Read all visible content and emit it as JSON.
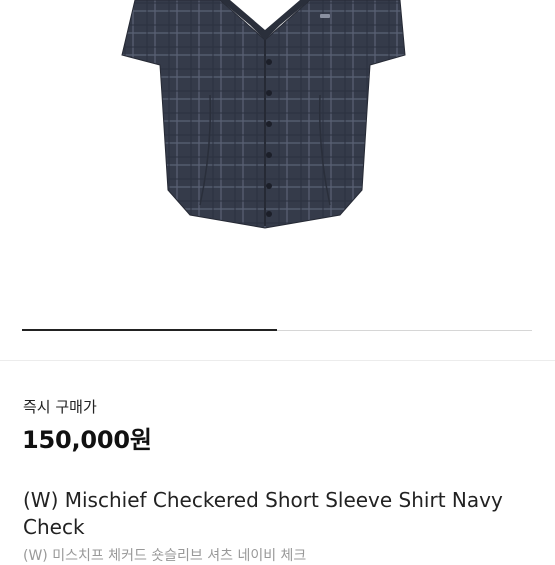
{
  "product": {
    "image_alt": "Navy check short sleeve shirt",
    "gallery": {
      "current": 1,
      "total": 2,
      "progress": 0.5
    },
    "price_label": "즉시 구매가",
    "price": "150,000원",
    "title": "(W) Mischief Checkered Short Sleeve Shirt Navy Check",
    "subtitle": "(W) 미스치프 체커드 숏슬리브 셔츠 네이비 체크"
  },
  "colors": {
    "shirt": "#353b4a",
    "check_line": "#5a6275",
    "button": "#1c1f29",
    "pager_active": "#222222",
    "pager_track": "#d6d6d6"
  }
}
